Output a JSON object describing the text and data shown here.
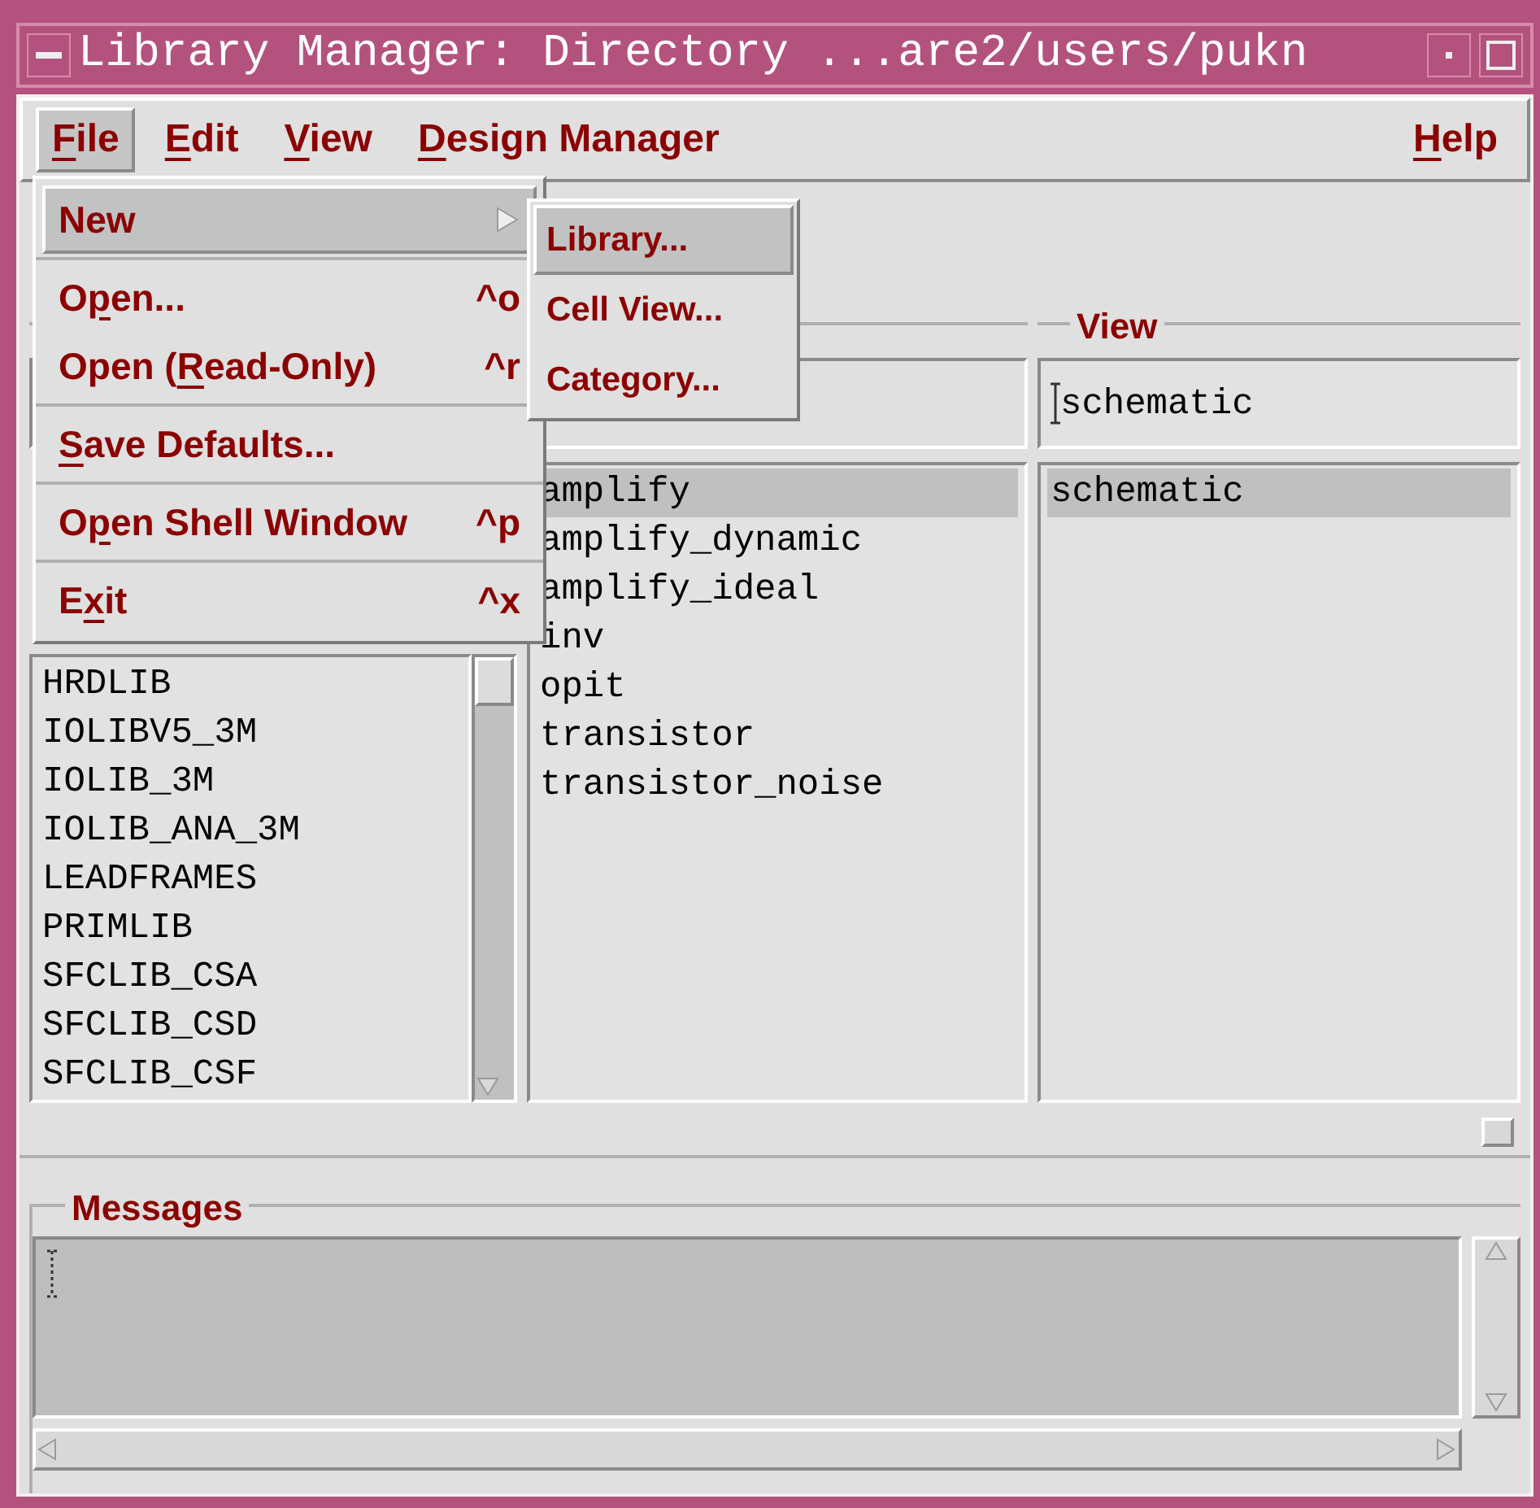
{
  "window": {
    "title": "Library Manager: Directory ...are2/users/pukn"
  },
  "menubar": [
    {
      "key": "F",
      "post": "ile",
      "selected": true
    },
    {
      "key": "E",
      "post": "dit",
      "selected": false
    },
    {
      "key": "V",
      "post": "iew",
      "selected": false
    },
    {
      "key": "D",
      "post": "esign Manager",
      "selected": false
    }
  ],
  "help_menu": {
    "key": "H",
    "post": "elp",
    "selected": false
  },
  "file_menu": [
    {
      "items": [
        {
          "kind": "submenu",
          "pre": "New",
          "selected": true
        }
      ]
    },
    {
      "items": [
        {
          "kind": "command",
          "pre": "O",
          "key": "p",
          "post": "en...",
          "shortcut": "^o",
          "selected": false
        },
        {
          "kind": "command",
          "pre": "Open (",
          "key": "R",
          "post": "ead-Only)",
          "shortcut": "^r",
          "selected": false
        }
      ]
    },
    {
      "items": [
        {
          "kind": "command",
          "key": "S",
          "post": "ave Defaults...",
          "selected": false
        }
      ]
    },
    {
      "items": [
        {
          "kind": "command",
          "pre": "O",
          "key": "p",
          "post": "en Shell Window",
          "shortcut": "^p",
          "selected": false
        }
      ]
    },
    {
      "items": [
        {
          "kind": "command",
          "pre": "E",
          "key": "x",
          "post": "it",
          "shortcut": "^x",
          "selected": false
        }
      ]
    }
  ],
  "new_submenu": [
    {
      "label": "Library...",
      "selected": true
    },
    {
      "label": "Cell View...",
      "selected": false
    },
    {
      "label": "Category...",
      "selected": false
    }
  ],
  "library_list": {
    "items": [
      {
        "label": "HRDLIB",
        "selected": false
      },
      {
        "label": "IOLIBV5_3M",
        "selected": false
      },
      {
        "label": "IOLIB_3M",
        "selected": false
      },
      {
        "label": "IOLIB_ANA_3M",
        "selected": false
      },
      {
        "label": "LEADFRAMES",
        "selected": false
      },
      {
        "label": "PRIMLIB",
        "selected": false
      },
      {
        "label": "SFCLIB_CSA",
        "selected": false
      },
      {
        "label": "SFCLIB_CSD",
        "selected": false
      },
      {
        "label": "SFCLIB_CSF",
        "selected": false
      }
    ]
  },
  "cell_list": {
    "items": [
      {
        "label": "amplify",
        "selected": true
      },
      {
        "label": "amplify_dynamic",
        "selected": false
      },
      {
        "label": "amplify_ideal",
        "selected": false
      },
      {
        "label": "inv",
        "selected": false
      },
      {
        "label": "opit",
        "selected": false
      },
      {
        "label": "transistor",
        "selected": false
      },
      {
        "label": "transistor_noise",
        "selected": false
      }
    ]
  },
  "view_column": {
    "header": "View",
    "value": "schematic",
    "items": [
      {
        "label": "schematic",
        "selected": true
      }
    ]
  },
  "messages": {
    "header": "Messages"
  }
}
